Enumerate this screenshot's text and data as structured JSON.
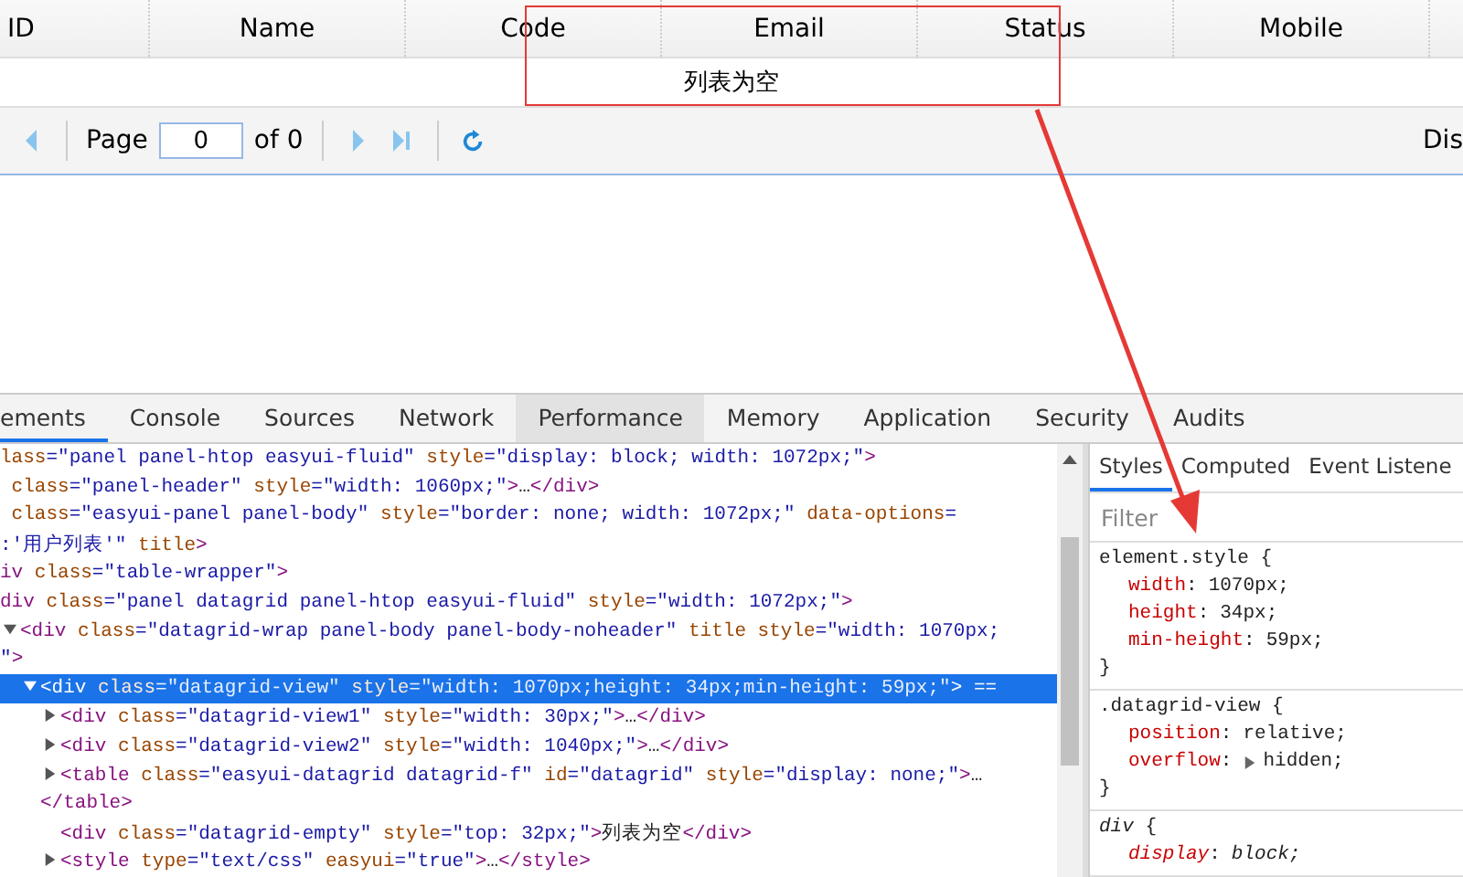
{
  "grid": {
    "columns": [
      "ID",
      "Name",
      "Code",
      "Email",
      "Status",
      "Mobile"
    ],
    "empty_message": "列表为空"
  },
  "pager": {
    "page_label": "Page",
    "page_value": "0",
    "of_label": "of 0",
    "display_text": "Dis"
  },
  "devtools": {
    "tabs": [
      {
        "label": "ements",
        "selected": true,
        "hovered": false
      },
      {
        "label": "Console",
        "selected": false,
        "hovered": false
      },
      {
        "label": "Sources",
        "selected": false,
        "hovered": false
      },
      {
        "label": "Network",
        "selected": false,
        "hovered": false
      },
      {
        "label": "Performance",
        "selected": false,
        "hovered": true
      },
      {
        "label": "Memory",
        "selected": false,
        "hovered": false
      },
      {
        "label": "Application",
        "selected": false,
        "hovered": false
      },
      {
        "label": "Security",
        "selected": false,
        "hovered": false
      },
      {
        "label": "Audits",
        "selected": false,
        "hovered": false
      }
    ],
    "elements": [
      {
        "selected": false,
        "tokens": [
          {
            "kind": "attr",
            "text": "lass"
          },
          {
            "kind": "value",
            "text": "=\"panel panel-htop easyui-fluid\""
          },
          {
            "kind": "attr",
            "text": " style"
          },
          {
            "kind": "value",
            "text": "=\"display: block; width: 1072px;\""
          },
          {
            "kind": "tag",
            "text": ">"
          }
        ]
      },
      {
        "selected": false,
        "tokens": [
          {
            "kind": "attr",
            "text": " class"
          },
          {
            "kind": "value",
            "text": "=\"panel-header\""
          },
          {
            "kind": "attr",
            "text": " style"
          },
          {
            "kind": "value",
            "text": "=\"width: 1060px;\""
          },
          {
            "kind": "tag",
            "text": ">"
          },
          {
            "kind": "text",
            "text": "…"
          },
          {
            "kind": "tag",
            "text": "</div>"
          }
        ]
      },
      {
        "selected": false,
        "tokens": [
          {
            "kind": "attr",
            "text": " class"
          },
          {
            "kind": "value",
            "text": "=\"easyui-panel panel-body\""
          },
          {
            "kind": "attr",
            "text": " style"
          },
          {
            "kind": "value",
            "text": "=\"border: none; width: 1072px;\""
          },
          {
            "kind": "attr",
            "text": " data-options"
          },
          {
            "kind": "value",
            "text": "="
          }
        ]
      },
      {
        "selected": false,
        "tokens": [
          {
            "kind": "value",
            "text": ":'用户列表'\""
          },
          {
            "kind": "attr",
            "text": " title"
          },
          {
            "kind": "tag",
            "text": ">"
          }
        ]
      },
      {
        "selected": false,
        "tokens": [
          {
            "kind": "tag",
            "text": "iv"
          },
          {
            "kind": "attr",
            "text": " class"
          },
          {
            "kind": "value",
            "text": "=\"table-wrapper\""
          },
          {
            "kind": "tag",
            "text": ">"
          }
        ]
      },
      {
        "selected": false,
        "tokens": [
          {
            "kind": "tag",
            "text": "div"
          },
          {
            "kind": "attr",
            "text": " class"
          },
          {
            "kind": "value",
            "text": "=\"panel datagrid panel-htop easyui-fluid\""
          },
          {
            "kind": "attr",
            "text": " style"
          },
          {
            "kind": "value",
            "text": "=\"width: 1072px;\""
          },
          {
            "kind": "tag",
            "text": ">"
          }
        ],
        "children": [
          {
            "selected": false,
            "expanded": true,
            "tokens": [
              {
                "kind": "tag",
                "text": "<div"
              },
              {
                "kind": "attr",
                "text": " class"
              },
              {
                "kind": "value",
                "text": "=\"datagrid-wrap panel-body panel-body-noheader\""
              },
              {
                "kind": "attr",
                "text": " title"
              },
              {
                "kind": "attr",
                "text": " style"
              },
              {
                "kind": "value",
                "text": "=\"width: 1070px;"
              }
            ],
            "continuation": [
              {
                "kind": "value",
                "text": "\""
              },
              {
                "kind": "tag",
                "text": ">"
              }
            ],
            "children": [
              {
                "selected": true,
                "expanded": true,
                "tokens": [
                  {
                    "kind": "tag",
                    "text": "<div"
                  },
                  {
                    "kind": "attr",
                    "text": " class"
                  },
                  {
                    "kind": "value",
                    "text": "=\"datagrid-view\""
                  },
                  {
                    "kind": "attr",
                    "text": " style"
                  },
                  {
                    "kind": "value",
                    "text": "=\"width: 1070px;height: 34px;min-height: 59px;\""
                  },
                  {
                    "kind": "tag",
                    "text": ">"
                  },
                  {
                    "kind": "text",
                    "text": " =="
                  }
                ],
                "children": [
                  {
                    "selected": false,
                    "expanded": false,
                    "tokens": [
                      {
                        "kind": "tag",
                        "text": "<div"
                      },
                      {
                        "kind": "attr",
                        "text": " class"
                      },
                      {
                        "kind": "value",
                        "text": "=\"datagrid-view1\""
                      },
                      {
                        "kind": "attr",
                        "text": " style"
                      },
                      {
                        "kind": "value",
                        "text": "=\"width: 30px;\""
                      },
                      {
                        "kind": "tag",
                        "text": ">"
                      },
                      {
                        "kind": "text",
                        "text": "…"
                      },
                      {
                        "kind": "tag",
                        "text": "</div>"
                      }
                    ]
                  },
                  {
                    "selected": false,
                    "expanded": false,
                    "tokens": [
                      {
                        "kind": "tag",
                        "text": "<div"
                      },
                      {
                        "kind": "attr",
                        "text": " class"
                      },
                      {
                        "kind": "value",
                        "text": "=\"datagrid-view2\""
                      },
                      {
                        "kind": "attr",
                        "text": " style"
                      },
                      {
                        "kind": "value",
                        "text": "=\"width: 1040px;\""
                      },
                      {
                        "kind": "tag",
                        "text": ">"
                      },
                      {
                        "kind": "text",
                        "text": "…"
                      },
                      {
                        "kind": "tag",
                        "text": "</div>"
                      }
                    ]
                  },
                  {
                    "selected": false,
                    "expanded": false,
                    "tokens": [
                      {
                        "kind": "tag",
                        "text": "<table"
                      },
                      {
                        "kind": "attr",
                        "text": " class"
                      },
                      {
                        "kind": "value",
                        "text": "=\"easyui-datagrid datagrid-f\""
                      },
                      {
                        "kind": "attr",
                        "text": " id"
                      },
                      {
                        "kind": "value",
                        "text": "=\"datagrid\""
                      },
                      {
                        "kind": "attr",
                        "text": " style"
                      },
                      {
                        "kind": "value",
                        "text": "=\"display: none;\""
                      },
                      {
                        "kind": "tag",
                        "text": ">"
                      },
                      {
                        "kind": "text",
                        "text": "…"
                      }
                    ],
                    "continuation": [
                      {
                        "kind": "tag",
                        "text": "</table>"
                      }
                    ]
                  },
                  {
                    "selected": false,
                    "tokens": [
                      {
                        "kind": "tag",
                        "text": "<div"
                      },
                      {
                        "kind": "attr",
                        "text": " class"
                      },
                      {
                        "kind": "value",
                        "text": "=\"datagrid-empty\""
                      },
                      {
                        "kind": "attr",
                        "text": " style"
                      },
                      {
                        "kind": "value",
                        "text": "=\"top: 32px;\""
                      },
                      {
                        "kind": "tag",
                        "text": ">"
                      },
                      {
                        "kind": "text",
                        "text": "列表为空"
                      },
                      {
                        "kind": "tag",
                        "text": "</div>"
                      }
                    ]
                  },
                  {
                    "selected": false,
                    "expanded": false,
                    "tokens": [
                      {
                        "kind": "tag",
                        "text": "<style"
                      },
                      {
                        "kind": "attr",
                        "text": " type"
                      },
                      {
                        "kind": "value",
                        "text": "=\"text/css\""
                      },
                      {
                        "kind": "attr",
                        "text": " easyui"
                      },
                      {
                        "kind": "value",
                        "text": "=\"true\""
                      },
                      {
                        "kind": "tag",
                        "text": ">"
                      },
                      {
                        "kind": "text",
                        "text": "…"
                      },
                      {
                        "kind": "tag",
                        "text": "</style>"
                      }
                    ]
                  }
                ]
              }
            ]
          }
        ]
      }
    ],
    "styles_tabs": [
      {
        "label": "Styles",
        "selected": true
      },
      {
        "label": "Computed",
        "selected": false
      },
      {
        "label": "Event Listene",
        "selected": false
      }
    ],
    "filter": {
      "placeholder": "Filter"
    },
    "rules": [
      {
        "selector": "element.style",
        "open": "{",
        "italic": false,
        "close": "}",
        "declarations": [
          {
            "property": "width",
            "colon": ":",
            "value": "1070px;"
          },
          {
            "property": "height",
            "colon": ":",
            "value": "34px;"
          },
          {
            "property": "min-height",
            "colon": ":",
            "value": "59px;"
          }
        ]
      },
      {
        "selector": ".datagrid-view",
        "open": "{",
        "italic": false,
        "close": "}",
        "declarations": [
          {
            "property": "position",
            "colon": ":",
            "value": "relative;"
          },
          {
            "property": "overflow",
            "colon": ":",
            "value": "hidden;",
            "expandable": true
          }
        ]
      },
      {
        "selector": "div",
        "open": "{",
        "italic": true,
        "declarations": [
          {
            "property": "display",
            "colon": ":",
            "value": "block;"
          }
        ]
      }
    ]
  }
}
